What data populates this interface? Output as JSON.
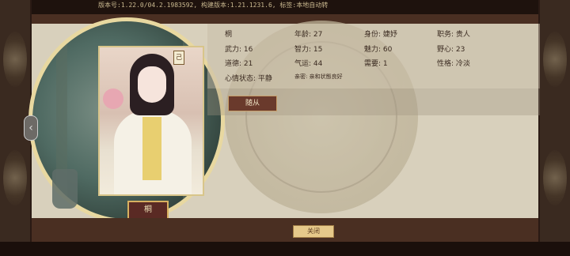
{
  "version_text": "版本号:1.22.0/04.2.1983592, 构建版本:1.21.1231.6, 标签:本地自动转",
  "character": {
    "name": "桐",
    "rank_badge": "己",
    "stats": {
      "row1": [
        "桐",
        "年龄: 27",
        "身份: 婕妤",
        "职务: 贵人"
      ],
      "row2": [
        "武力: 16",
        "智力: 15",
        "魅力: 60",
        "野心: 23"
      ],
      "row3": [
        "道德: 21",
        "气运: 44",
        "需要: 1",
        "性格: 冷淡"
      ],
      "row4": [
        "心情状态: 平静",
        "亲密: 亲和状態良好"
      ]
    }
  },
  "buttons": {
    "follow": "随从",
    "close": "关闭"
  },
  "icons": {
    "prev_arrow": "chevron-left-icon"
  }
}
